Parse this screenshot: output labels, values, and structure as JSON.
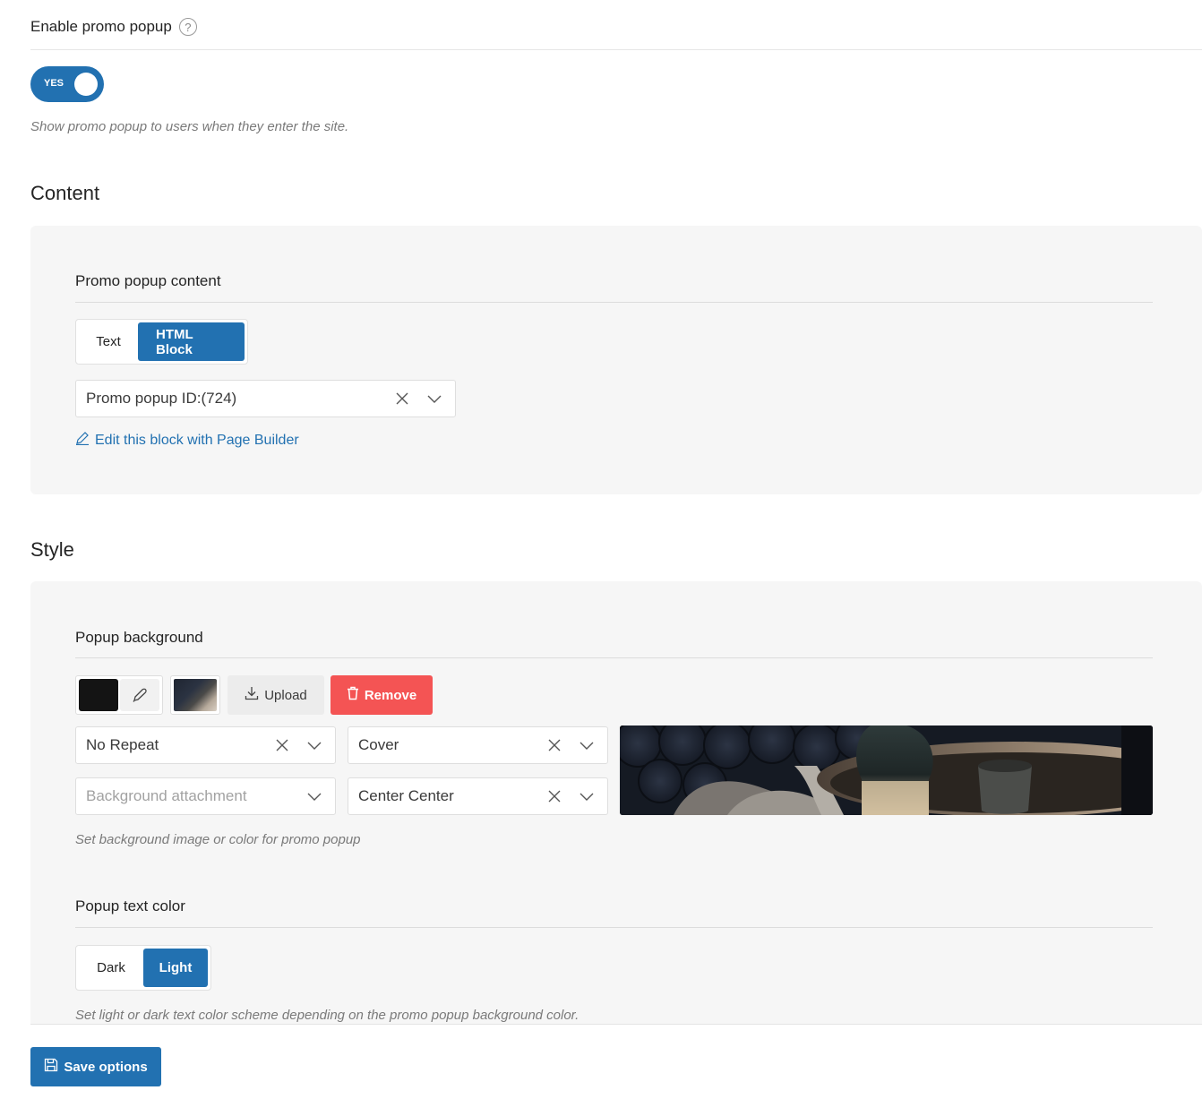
{
  "enable_popup": {
    "title": "Enable promo popup",
    "help_glyph": "?",
    "toggle_label": "YES",
    "toggle_on": true,
    "description": "Show promo popup to users when they enter the site."
  },
  "content_section": {
    "heading": "Content",
    "field_title": "Promo popup content",
    "tabs": [
      {
        "label": "Text",
        "active": false
      },
      {
        "label": "HTML Block",
        "active": true
      }
    ],
    "select_value": "Promo popup ID:(724)",
    "edit_link": "Edit this block with Page Builder"
  },
  "style_section": {
    "heading": "Style",
    "background": {
      "field_title": "Popup background",
      "color_value": "#141414",
      "upload_label": "Upload",
      "remove_label": "Remove",
      "repeat_value": "No Repeat",
      "size_value": "Cover",
      "attachment_placeholder": "Background attachment",
      "position_value": "Center Center",
      "description": "Set background image or color for promo popup"
    },
    "text_color": {
      "field_title": "Popup text color",
      "tabs": [
        {
          "label": "Dark",
          "active": false
        },
        {
          "label": "Light",
          "active": true
        }
      ],
      "description": "Set light or dark text color scheme depending on the promo popup background color."
    }
  },
  "footer": {
    "save_label": "Save options"
  },
  "colors": {
    "accent": "#2271b1",
    "danger": "#f45454",
    "panel_bg": "#f6f6f6"
  }
}
